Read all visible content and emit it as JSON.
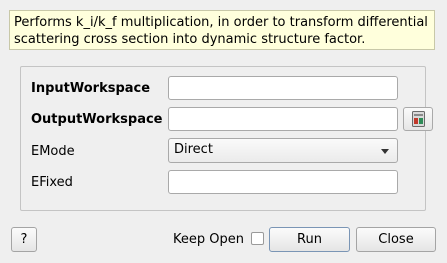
{
  "description": "Performs k_i/k_f multiplication, in order to transform differential scattering cross section into dynamic structure factor.",
  "properties": {
    "input_workspace": {
      "label": "InputWorkspace",
      "value": ""
    },
    "output_workspace": {
      "label": "OutputWorkspace",
      "value": ""
    },
    "emode": {
      "label": "EMode",
      "selected": "Direct"
    },
    "efixed": {
      "label": "EFixed",
      "value": ""
    }
  },
  "footer": {
    "help_label": "?",
    "keep_open_label": "Keep Open",
    "keep_open_checked": false,
    "run_label": "Run",
    "close_label": "Close"
  },
  "icons": {
    "browse": "workspace-browse-icon",
    "dropdown": "chevron-down-icon"
  }
}
